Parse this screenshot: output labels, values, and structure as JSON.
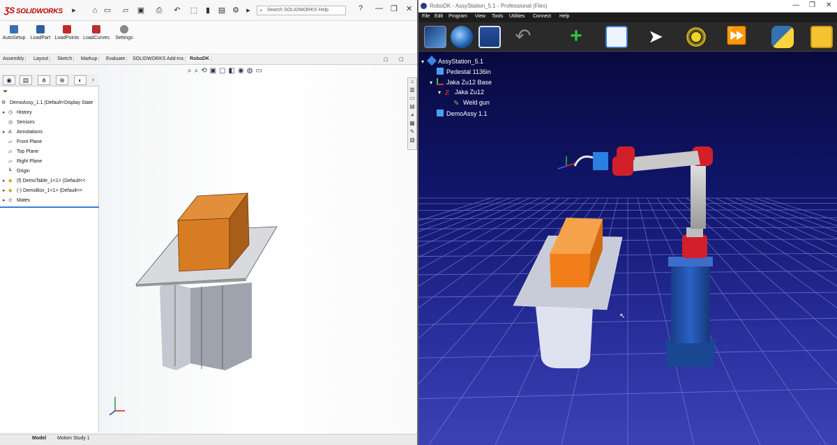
{
  "solidworks": {
    "logo_text": "SOLIDWORKS",
    "search_placeholder": "Search SOLIDWORKS Help",
    "ribbon_buttons": [
      {
        "label": "AutoSetup"
      },
      {
        "label": "LoadPart"
      },
      {
        "label": "LoadPoints"
      },
      {
        "label": "LoadCurves"
      },
      {
        "label": "Settings"
      }
    ],
    "tabs": [
      "Assembly",
      "Layout",
      "Sketch",
      "Markup",
      "Evaluate",
      "SOLIDWORKS Add-Ins",
      "RoboDK"
    ],
    "active_tab": "RoboDK",
    "tree": [
      {
        "label": "DemoAssy_1.1 (Default<Display State",
        "indent": 0,
        "expander": ""
      },
      {
        "label": "History",
        "indent": 1,
        "expander": "▸"
      },
      {
        "label": "Sensors",
        "indent": 1,
        "expander": ""
      },
      {
        "label": "Annotations",
        "indent": 1,
        "expander": "▸"
      },
      {
        "label": "Front Plane",
        "indent": 1,
        "expander": ""
      },
      {
        "label": "Top Plane",
        "indent": 1,
        "expander": ""
      },
      {
        "label": "Right Plane",
        "indent": 1,
        "expander": ""
      },
      {
        "label": "Origin",
        "indent": 1,
        "expander": ""
      },
      {
        "label": "(f) DemoTable_1<1> (Default<<",
        "indent": 1,
        "expander": "▸"
      },
      {
        "label": "(-) DemoBox_1<1> (Default<<",
        "indent": 1,
        "expander": "▸"
      },
      {
        "label": "Mates",
        "indent": 1,
        "expander": "▸"
      }
    ],
    "bottom_tabs": [
      "Model",
      "Motion Study 1"
    ],
    "colors": {
      "brand": "#c00000",
      "box": "#d9822b",
      "plate": "#d0d0d0"
    }
  },
  "robodk": {
    "window_title": "RoboDK - AssyStation_5.1 - Professional (Flex)",
    "menu": [
      "File",
      "Edit",
      "Program",
      "View",
      "Tools",
      "Utilities",
      "Connect",
      "Help"
    ],
    "tree": [
      {
        "label": "AssyStation_5.1",
        "indent": 0,
        "expander": "▾",
        "icon": "station"
      },
      {
        "label": "Pedestal 1136in",
        "indent": 1,
        "expander": "",
        "icon": "object"
      },
      {
        "label": "Jaka Zu12 Base",
        "indent": 1,
        "expander": "▾",
        "icon": "frame"
      },
      {
        "label": "Jaka Zu12",
        "indent": 2,
        "expander": "▾",
        "icon": "robot"
      },
      {
        "label": "Weld gun",
        "indent": 3,
        "expander": "",
        "icon": "tool"
      },
      {
        "label": "DemoAssy 1.1",
        "indent": 1,
        "expander": "",
        "icon": "object"
      }
    ],
    "toolbar_icons": [
      "open-icon",
      "world-icon",
      "save-icon",
      "undo-icon",
      "add-frame-icon",
      "fit-all-icon",
      "select-icon",
      "collision-icon",
      "run-icon",
      "python-icon",
      "package-icon"
    ],
    "colors": {
      "bg_top": "#080a3e",
      "bg_bottom": "#3b42b4",
      "box": "#f07e18",
      "robot_red": "#d21f2a",
      "pedestal": "#1e4fa8"
    }
  }
}
